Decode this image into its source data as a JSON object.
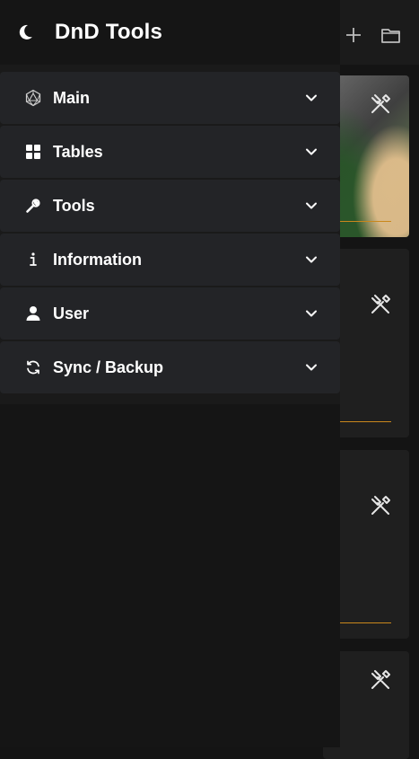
{
  "app": {
    "title": "DnD Tools"
  },
  "toolbar": {
    "add_icon": "plus-icon",
    "open_icon": "folder-icon"
  },
  "menu": {
    "items": [
      {
        "label": "Main",
        "icon": "d20-icon"
      },
      {
        "label": "Tables",
        "icon": "grid-icon"
      },
      {
        "label": "Tools",
        "icon": "wrench-icon"
      },
      {
        "label": "Information",
        "icon": "info-icon"
      },
      {
        "label": "User",
        "icon": "user-icon"
      },
      {
        "label": "Sync / Backup",
        "icon": "sync-icon"
      }
    ]
  },
  "colors": {
    "accent_line": "#c9871c",
    "menu_bg": "#232427"
  }
}
